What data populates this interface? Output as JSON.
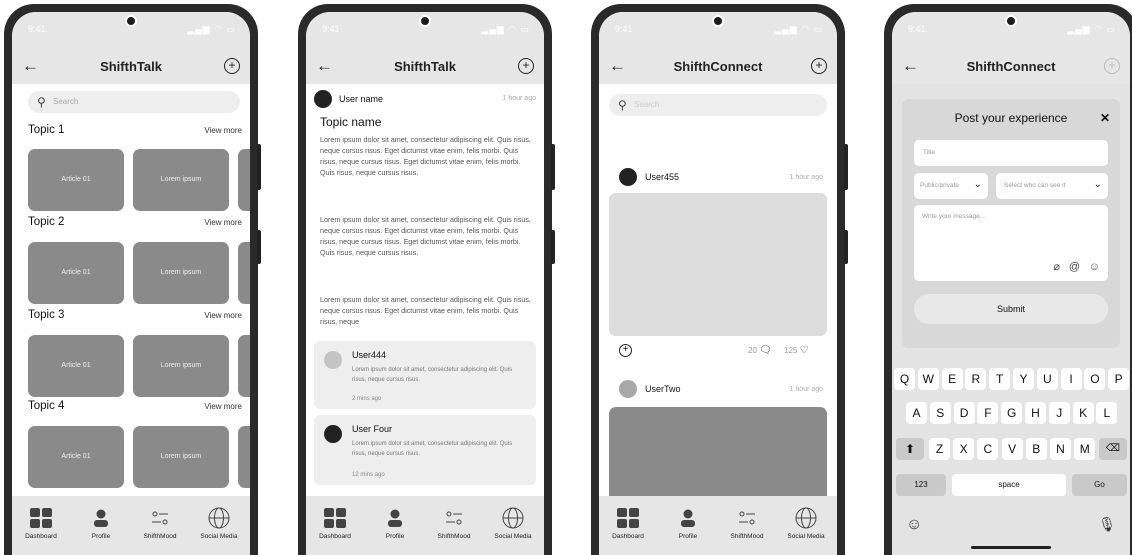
{
  "status": {
    "time": "9:41"
  },
  "screen1": {
    "title": "ShifthTalk",
    "search_placeholder": "Search",
    "topics": [
      {
        "label": "Topic 1",
        "view_more": "View more",
        "cards": [
          "Article 01",
          "Lorem ipsum"
        ]
      },
      {
        "label": "Topic 2",
        "view_more": "View more",
        "cards": [
          "Article 01",
          "Lorem ipsum"
        ]
      },
      {
        "label": "Topic 3",
        "view_more": "View more",
        "cards": [
          "Article 01",
          "Lorem ipsum"
        ]
      },
      {
        "label": "Topic 4",
        "view_more": "View more",
        "cards": [
          "Article 01",
          "Lorem ipsum"
        ]
      }
    ]
  },
  "screen2": {
    "title": "ShifthTalk",
    "user": "User name",
    "time": "1 hour ago",
    "topic_name": "Topic name",
    "paragraph1": "Lorem ipsum dolor sit amet, consectetur adipiscing elit. Quis risus, neque cursus risus. Eget dictumst vitae enim, felis morbi. Quis risus, neque cursus risus. Eget dictumst vitae enim, felis morbi. Quis risus, neque cursus risus.",
    "paragraph2": "Lorem ipsum dolor sit amet, consectetur adipiscing elit. Quis risus, neque cursus risus. Eget dictumst vitae enim, felis morbi. Quis risus, neque cursus risus. Eget dictumst vitae enim, felis morbi. Quis risus, neque cursus risus.",
    "paragraph3": "Lorem ipsum dolor sit amet, consectetur adipiscing elit. Quis risus, neque cursus risus. Eget dictumst vitae enim, felis morbi. Quis risus, neque",
    "comments": [
      {
        "user": "User444",
        "text": "Lorem ipsum dolor sit amet, consectetur adipiscing elit. Quis risus, neque cursus risus.",
        "time": "2 mins ago"
      },
      {
        "user": "User Four",
        "text": "Lorem ipsum dolor sit amet, consectetur adipiscing elit. Quis risus, neque cursus risus.",
        "time": "12 mins ago"
      }
    ]
  },
  "screen3": {
    "title": "ShifthConnect",
    "search_placeholder": "Search",
    "posts": [
      {
        "user": "User455",
        "time": "1 hour ago",
        "comments": "20",
        "likes": "125"
      },
      {
        "user": "UserTwo",
        "time": "1 hour ago"
      }
    ]
  },
  "screen4": {
    "title": "ShifthConnect",
    "modal_title": "Post your experience",
    "close": "✕",
    "title_placeholder": "Title",
    "privacy_select": "Public/private",
    "audience_select": "Select who can see it",
    "message_placeholder": "Write your message...",
    "submit": "Submit",
    "keyboard": {
      "row1": [
        "Q",
        "W",
        "E",
        "R",
        "T",
        "Y",
        "U",
        "I",
        "O",
        "P"
      ],
      "row2": [
        "A",
        "S",
        "D",
        "F",
        "G",
        "H",
        "J",
        "K",
        "L"
      ],
      "row3": [
        "Z",
        "X",
        "C",
        "V",
        "B",
        "N",
        "M"
      ],
      "num": "123",
      "space": "space",
      "go": "Go"
    }
  },
  "nav": {
    "dashboard": "Dashboard",
    "profile": "Profile",
    "mood": "ShifthMood",
    "social": "Social Media"
  }
}
